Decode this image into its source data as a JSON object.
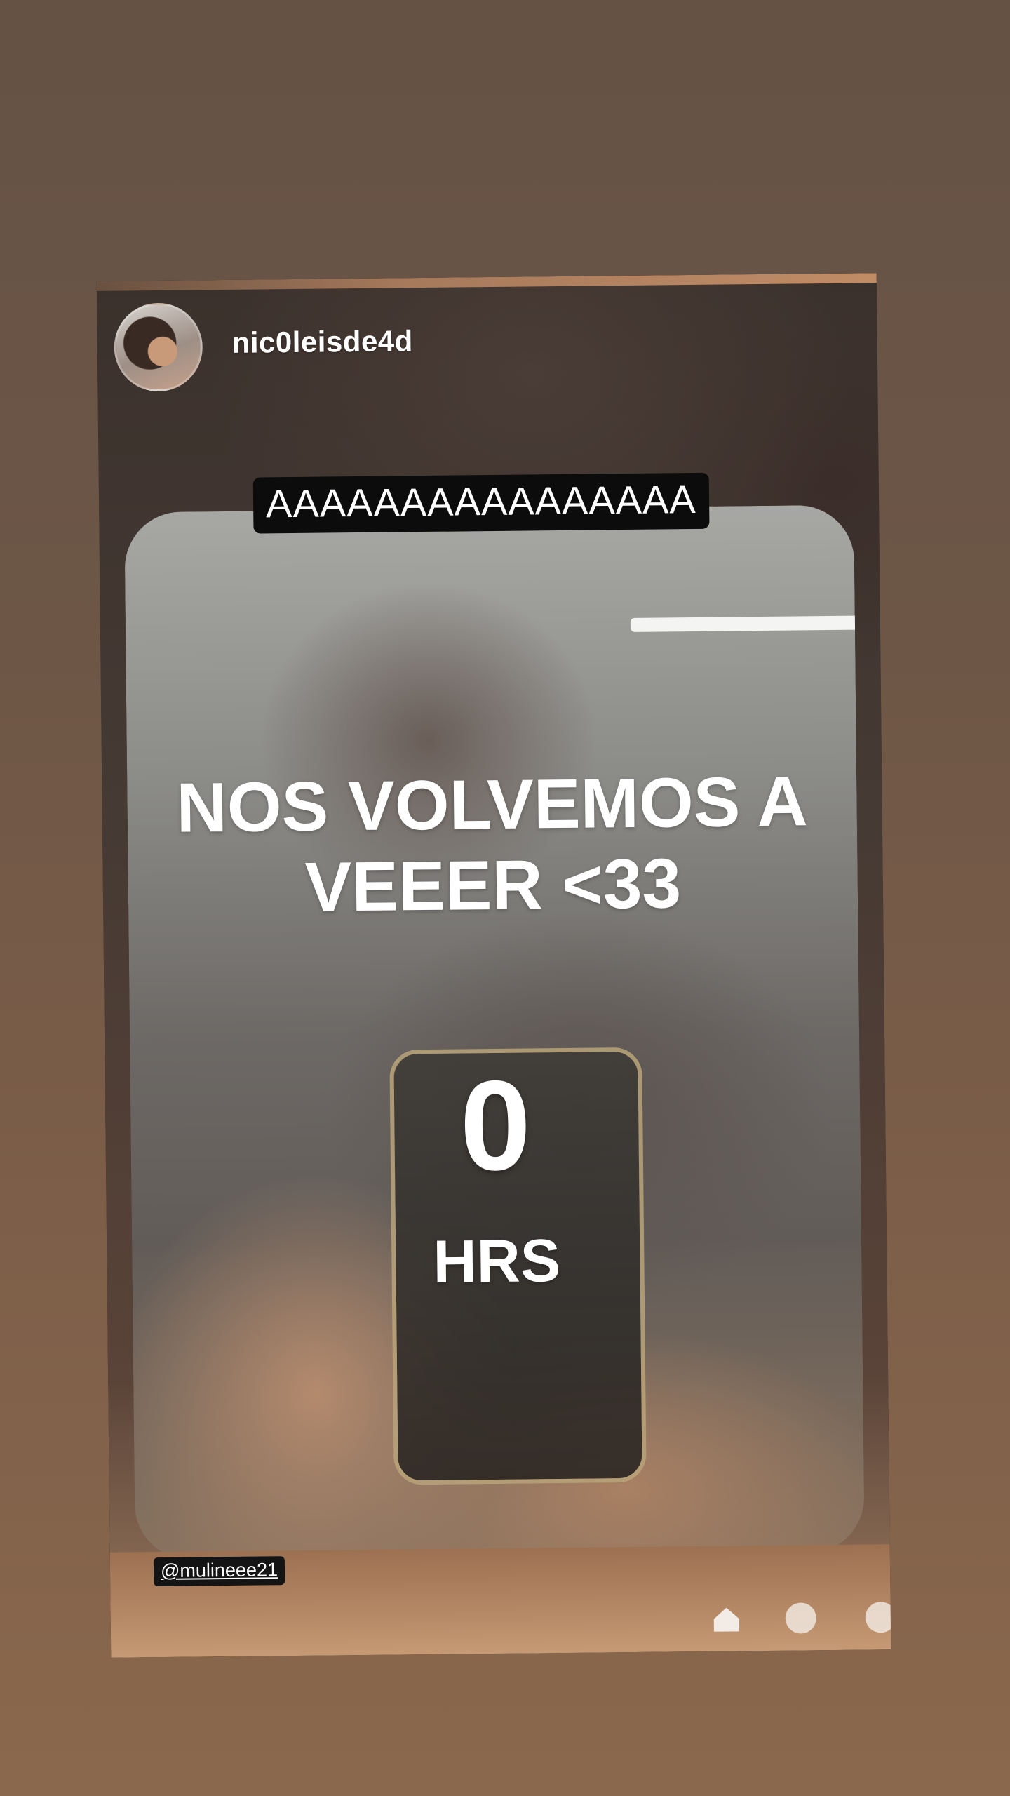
{
  "story": {
    "username": "nic0leisde4d",
    "avatar_icon": "profile-avatar",
    "caption_top": "AAAAAAAAAAAAAAAA",
    "headline_line1": "NOS VOLVEMOS A",
    "headline_line2": "VEEER <33",
    "countdown_value": "0",
    "countdown_unit": "HRS",
    "mention": "@mulineee21",
    "nav_icons": [
      "home-icon",
      "dot-icon",
      "dot-icon"
    ]
  },
  "colors": {
    "background": "#6d5646",
    "caption_bg": "#0c0c0c",
    "text": "#ffffff"
  }
}
